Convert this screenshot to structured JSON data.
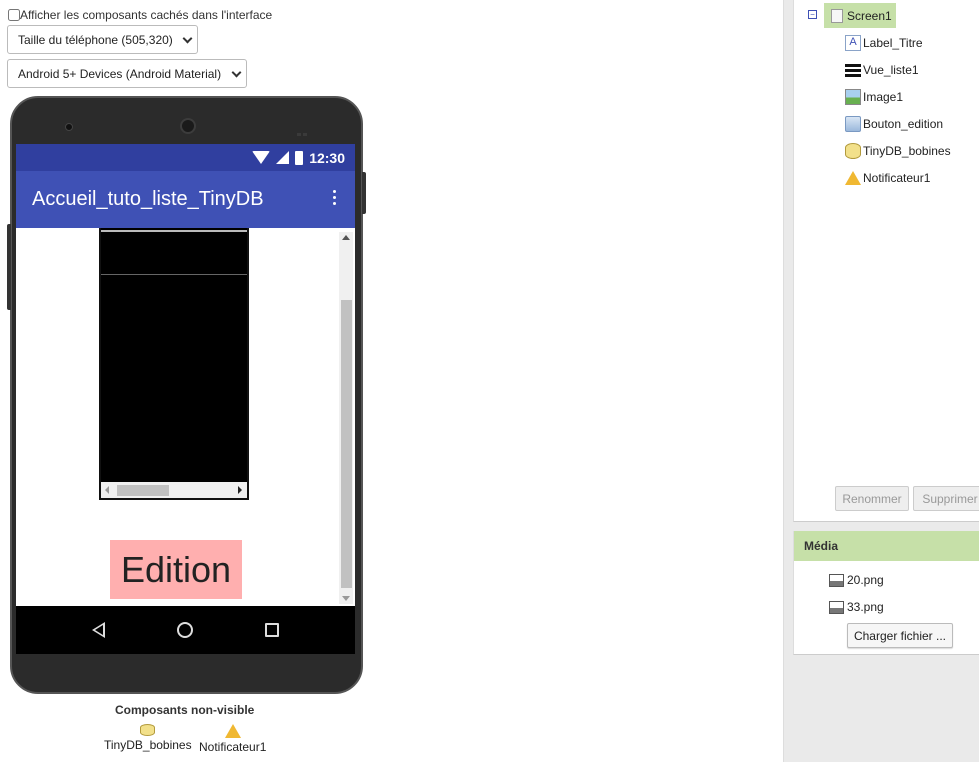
{
  "viewer": {
    "show_hidden_label": "Afficher les composants cachés dans l'interface",
    "phone_size_select": "Taille du téléphone (505,320)",
    "theme_select": "Android 5+ Devices (Android Material)"
  },
  "phone": {
    "status_time": "12:30",
    "app_title": "Accueil_tuto_liste_TinyDB",
    "edit_button": "Edition",
    "status_bar_color": "#303f9f",
    "app_bar_color": "#3f51b5",
    "edit_button_color": "#ffafaf"
  },
  "nonvisible": {
    "title": "Composants non-visible",
    "items": [
      {
        "label": "TinyDB_bobines",
        "icon": "database-icon"
      },
      {
        "label": "Notificateur1",
        "icon": "warning-icon"
      }
    ]
  },
  "components": {
    "root": "Screen1",
    "items": [
      {
        "label": "Label_Titre",
        "icon": "label-icon"
      },
      {
        "label": "Vue_liste1",
        "icon": "listview-icon"
      },
      {
        "label": "Image1",
        "icon": "image-icon"
      },
      {
        "label": "Bouton_edition",
        "icon": "button-icon"
      },
      {
        "label": "TinyDB_bobines",
        "icon": "database-icon"
      },
      {
        "label": "Notificateur1",
        "icon": "warning-icon"
      }
    ],
    "rename_button": "Renommer",
    "delete_button": "Supprimer",
    "selected_color": "#c6e0a8"
  },
  "media": {
    "title": "Média",
    "files": [
      "20.png",
      "33.png"
    ],
    "upload_button": "Charger fichier ..."
  }
}
